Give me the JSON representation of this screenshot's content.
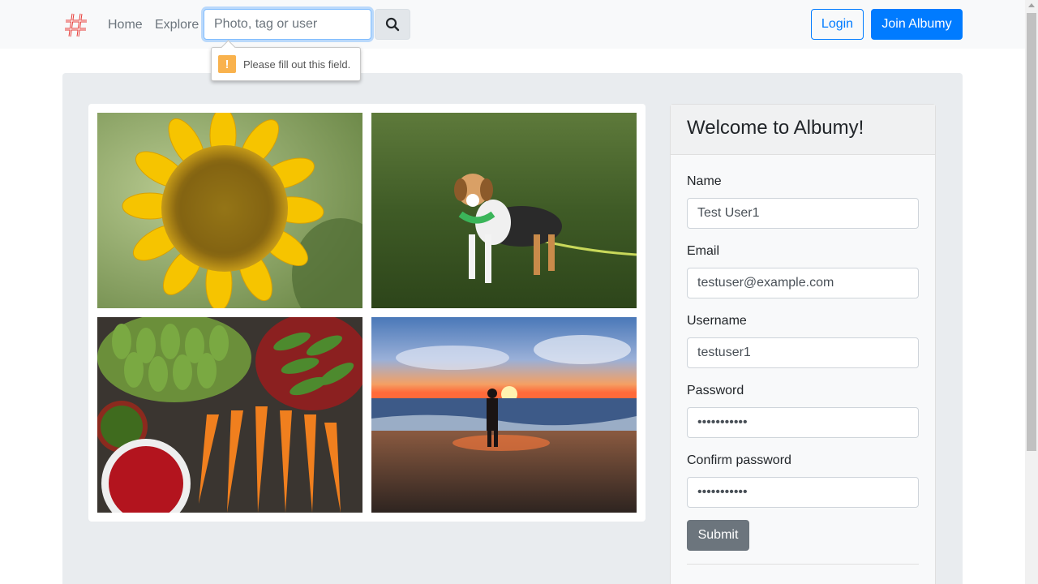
{
  "navbar": {
    "links": {
      "home": "Home",
      "explore": "Explore"
    },
    "search": {
      "placeholder": "Photo, tag or user",
      "value": ""
    },
    "login_label": "Login",
    "join_label": "Join Albumy"
  },
  "validation_tooltip": {
    "message": "Please fill out this field.",
    "icon": "!"
  },
  "signup": {
    "title": "Welcome to Albumy!",
    "fields": {
      "name": {
        "label": "Name",
        "value": "Test User1"
      },
      "email": {
        "label": "Email",
        "value": "testuser@example.com"
      },
      "username": {
        "label": "Username",
        "value": "testuser1"
      },
      "password": {
        "label": "Password",
        "value": "•••••••••••"
      },
      "confirm": {
        "label": "Confirm password",
        "value": "•••••••••••"
      }
    },
    "submit_label": "Submit"
  },
  "colors": {
    "primary": "#007bff",
    "secondary": "#6c757d",
    "logo": "#e53935"
  }
}
